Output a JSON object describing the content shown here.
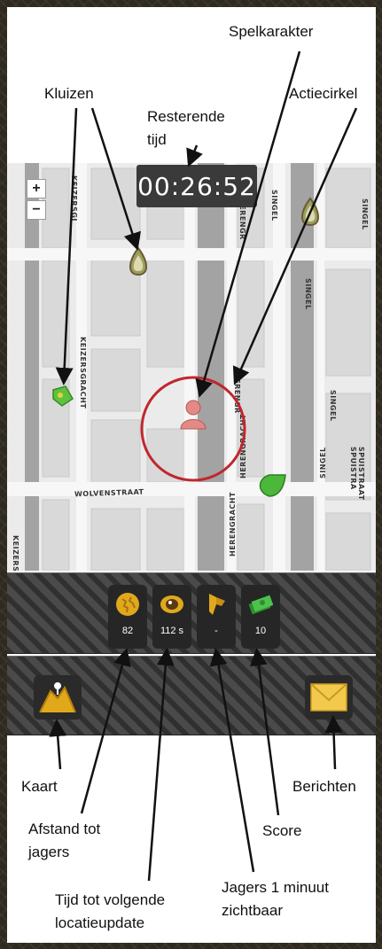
{
  "timer": {
    "value": "00:26:52"
  },
  "map": {
    "zoom_in": "+",
    "zoom_out": "−",
    "streets": {
      "keizersgracht_top": "KEIZERSGI",
      "keizersgracht_mid": "KEIZERSGRACHT",
      "keizersgracht_bottom": "KEIZERSGRACHT",
      "herengracht_top": "HERENGR",
      "herengracht_mid": "HERENGR",
      "herengracht_low": "HERENGRACHT",
      "herengracht_bottom": "HERENGRACHT",
      "singel_top": "SINGEL",
      "singel_right": "SINGEL",
      "singel_mid": "SINGEL",
      "singel_low": "SINGEL",
      "singel_bottom": "SINGEL",
      "wolvenstraat": "WOLVENSTRAAT",
      "spuistraat": "SPUISTRAAT SPUISTRA"
    }
  },
  "stats": [
    {
      "icon": "globe-icon",
      "value": "82",
      "color": "#e0a91c"
    },
    {
      "icon": "eye-icon",
      "value": "112 s",
      "color": "#e0a91c"
    },
    {
      "icon": "binoculars-icon",
      "value": "-",
      "color": "#e0a91c"
    },
    {
      "icon": "money-icon",
      "value": "10",
      "color": "#3aa83a"
    }
  ],
  "buttons": {
    "map_icon": "map-icon",
    "messages_icon": "envelope-icon"
  },
  "annotations": {
    "spelkarakter": "Spelkarakter",
    "kluizen": "Kluizen",
    "actiecirkel": "Actiecirkel",
    "resterende_1": "Resterende",
    "resterende_2": "tijd",
    "kaart": "Kaart",
    "berichten": "Berichten",
    "afstand_1": "Afstand tot",
    "afstand_2": "jagers",
    "score": "Score",
    "tijd_1": "Tijd tot volgende",
    "tijd_2": "locatieupdate",
    "jagers_1": "Jagers 1 minuut",
    "jagers_2": "zichtbaar"
  },
  "colors": {
    "action_circle": "#c0272d",
    "safe_green": "#3aa83a",
    "icon_gold": "#e0a91c",
    "character": "#e38a86"
  }
}
